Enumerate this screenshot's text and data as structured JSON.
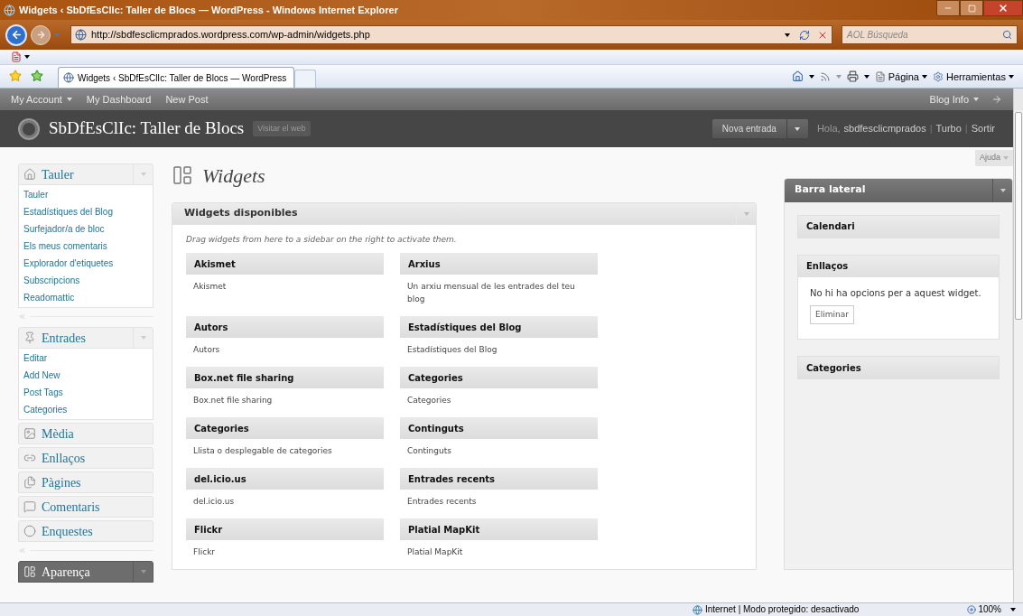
{
  "browser": {
    "title": "Widgets ‹ SbDfEsClIc: Taller de Blocs — WordPress - Windows Internet Explorer",
    "url": "http://sbdfesclicmprados.wordpress.com/wp-admin/widgets.php",
    "search_placeholder": "AOL Búsqueda",
    "tab_title": "Widgets ‹ SbDfEsClIc: Taller de Blocs — WordPress",
    "tools": [
      "Página",
      "Herramientas"
    ],
    "status": "Internet | Modo protegido: desactivado",
    "zoom": "100%"
  },
  "admin_bar": {
    "items": [
      {
        "label": "My Account",
        "kind": "menu"
      },
      {
        "label": "My Dashboard",
        "kind": "link"
      },
      {
        "label": "New Post",
        "kind": "link"
      }
    ],
    "right": {
      "label": "Blog Info",
      "kind": "menu"
    }
  },
  "header": {
    "site_title": "SbDfEsClIc: Taller de Blocs",
    "visit": "Visitar el web",
    "new_post": "Nova entrada",
    "greeting": "Hola,",
    "user": "sbdfesclicmprados",
    "links": [
      "Turbo",
      "Sortir"
    ],
    "separator": "|",
    "help": "Ajuda"
  },
  "menu": [
    {
      "label": "Tauler",
      "expanded": true,
      "selected": false,
      "items": [
        "Tauler",
        "Estadístiques del Blog",
        "Surfejador/a de bloc",
        "Els meus comentaris",
        "Explorador d'etiquetes",
        "Subscripcions",
        "Readomattic"
      ],
      "separator_after": true
    },
    {
      "label": "Entrades",
      "expanded": true,
      "selected": false,
      "items": [
        "Editar",
        "Add New",
        "Post Tags",
        "Categories"
      ],
      "separator_after": false
    },
    {
      "label": "Mèdia",
      "expanded": false,
      "selected": false,
      "separator_after": false
    },
    {
      "label": "Enllaços",
      "expanded": false,
      "selected": false,
      "separator_after": false
    },
    {
      "label": "Pàgines",
      "expanded": false,
      "selected": false,
      "separator_after": false
    },
    {
      "label": "Comentaris",
      "expanded": false,
      "selected": false,
      "separator_after": false
    },
    {
      "label": "Enquestes",
      "expanded": false,
      "selected": false,
      "separator_after": true
    },
    {
      "label": "Aparença",
      "expanded": false,
      "selected": true,
      "separator_after": false
    }
  ],
  "page_title": "Widgets",
  "available": {
    "title": "Widgets disponibles",
    "hint": "Drag widgets from here to a sidebar on the right to activate them.",
    "widgets": [
      {
        "title": "Akismet",
        "description": "Akismet"
      },
      {
        "title": "Arxius",
        "description": "Un arxiu mensual de les entrades del teu blog"
      },
      {
        "title": "Autors",
        "description": "Autors"
      },
      {
        "title": "Estadístiques del Blog",
        "description": "Estadístiques del Blog"
      },
      {
        "title": "Box.net file sharing",
        "description": "Box.net file sharing"
      },
      {
        "title": "Categories",
        "description": "Categories"
      },
      {
        "title": "Categories",
        "description": "Llista o desplegable de categories"
      },
      {
        "title": "Continguts",
        "description": "Continguts"
      },
      {
        "title": "del.icio.us",
        "description": "del.icio.us"
      },
      {
        "title": "Entrades recents",
        "description": "Entrades recents"
      },
      {
        "title": "Flickr",
        "description": "Flickr"
      },
      {
        "title": "Platial MapKit",
        "description": "Platial MapKit"
      }
    ]
  },
  "sidebar_area": {
    "title": "Barra lateral",
    "widgets": [
      {
        "title": "Calendari",
        "expanded": false
      },
      {
        "title": "Enllaços",
        "expanded": true,
        "body": "No hi ha opcions per a aquest widget.",
        "button": "Eliminar"
      },
      {
        "title": "Categories",
        "expanded": false
      }
    ]
  }
}
